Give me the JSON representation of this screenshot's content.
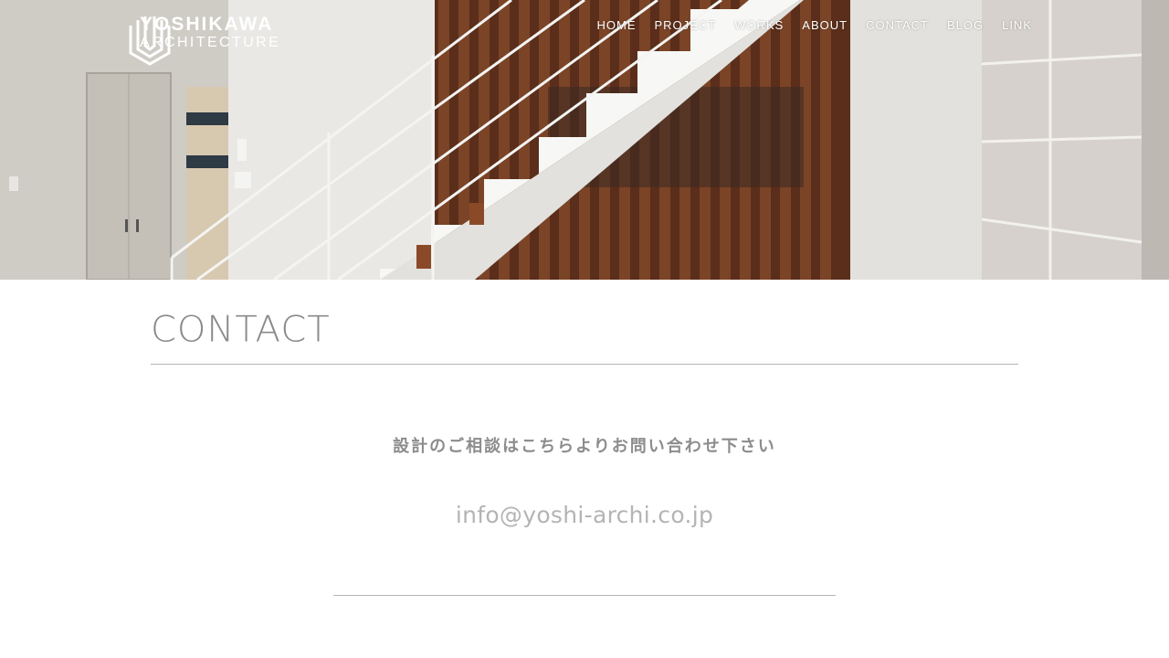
{
  "header": {
    "logo": {
      "line1": "YOSHIKAWA",
      "line2": "ARCHITECTURE"
    },
    "nav": [
      {
        "label": "HOME"
      },
      {
        "label": "PROJECT"
      },
      {
        "label": "WORKS"
      },
      {
        "label": "ABOUT"
      },
      {
        "label": "CONTACT"
      },
      {
        "label": "BLOG"
      },
      {
        "label": "LINK"
      }
    ]
  },
  "main": {
    "title": "CONTACT",
    "lead": "設計のご相談はこちらよりお問い合わせ下さい",
    "email": "info@yoshi-archi.co.jp"
  },
  "colors": {
    "text_gray": "#8a8a8a",
    "email_gray": "#b4b4b4",
    "rule": "#b5b5b5",
    "wood": "#6a3a22"
  }
}
